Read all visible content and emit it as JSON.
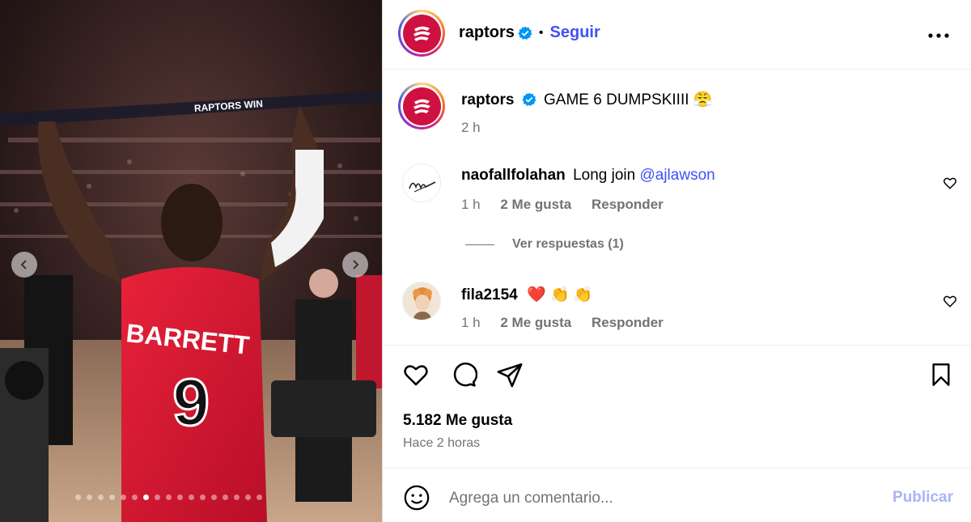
{
  "media": {
    "jersey_name": "BARRETT",
    "jersey_number": "9",
    "arena_banner": "RAPTORS WIN",
    "carousel_count": 17,
    "carousel_active": 6
  },
  "header": {
    "username": "raptors",
    "separator": "•",
    "follow_label": "Seguir",
    "more_label": "•••"
  },
  "caption": {
    "username": "raptors",
    "text": "GAME 6 DUMPSKIIII 😤",
    "time": "2 h"
  },
  "comments": [
    {
      "username": "naofallfolahan",
      "text": "Long join ",
      "mention": "@ajlawson",
      "time": "1 h",
      "likes": "2 Me gusta",
      "reply_label": "Responder",
      "view_replies": "Ver respuestas (1)"
    },
    {
      "username": "fila2154",
      "text": "❤️ 👏 👏",
      "time": "1 h",
      "likes": "2 Me gusta",
      "reply_label": "Responder"
    }
  ],
  "stats": {
    "likes": "5.182 Me gusta",
    "posted": "Hace 2 horas"
  },
  "composer": {
    "placeholder": "Agrega un comentario...",
    "publish_label": "Publicar"
  },
  "colors": {
    "accent": "#4150f7",
    "raptors_red": "#ce1141",
    "muted": "#737373",
    "publish_disabled": "#a8b4f8"
  }
}
